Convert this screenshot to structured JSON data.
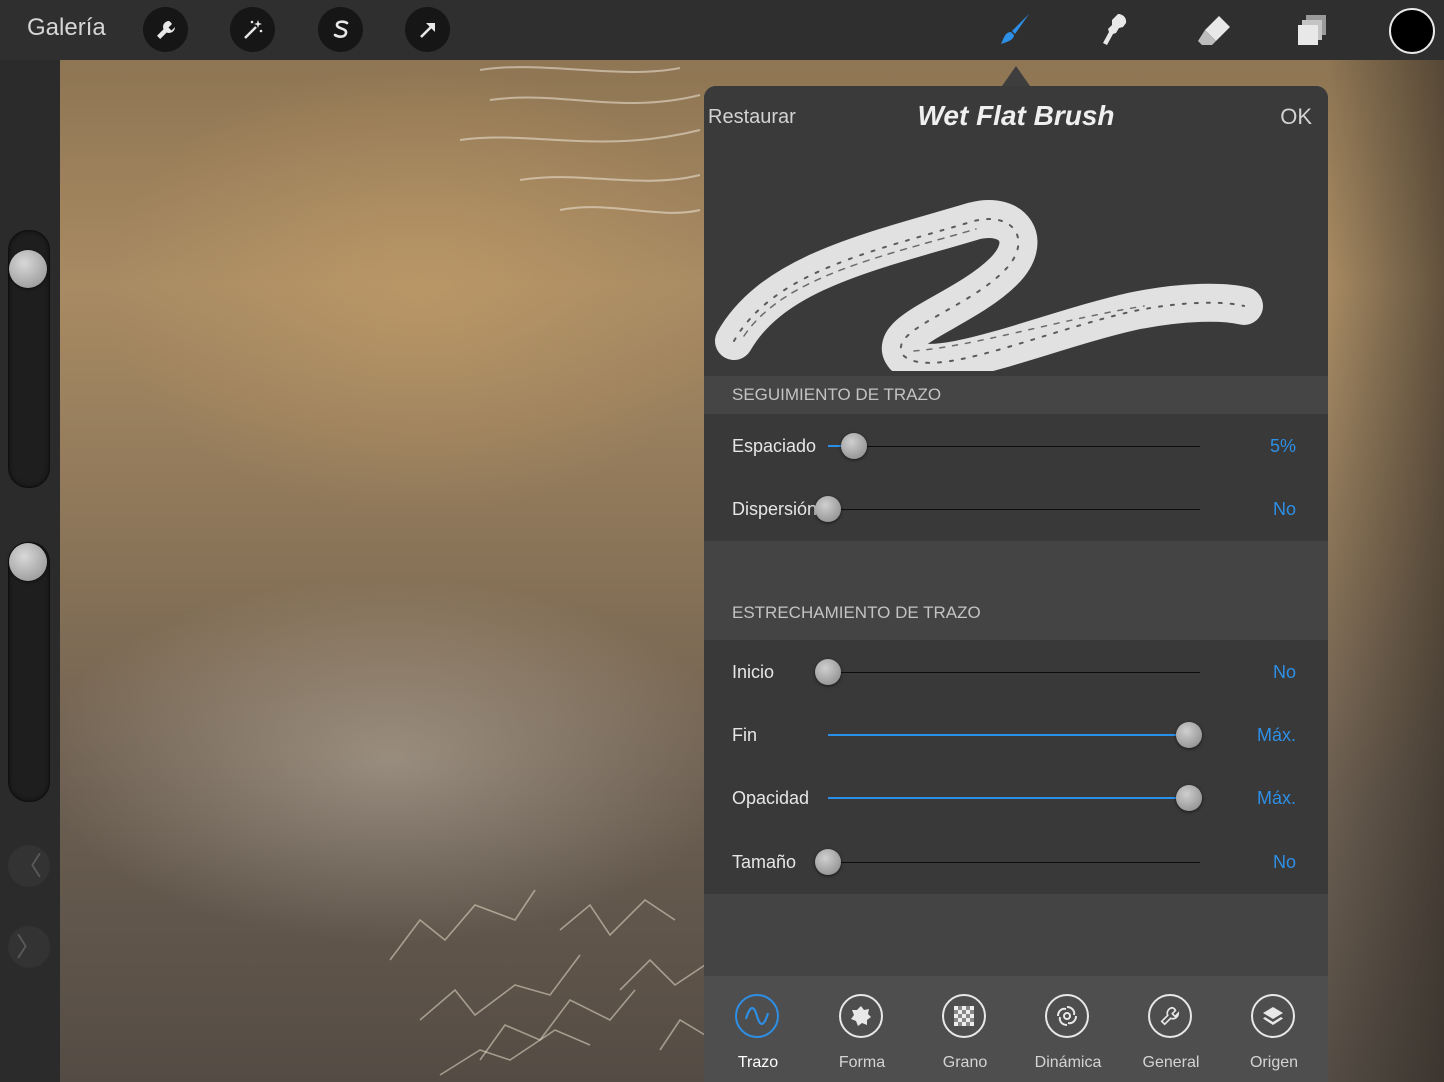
{
  "toolbar": {
    "gallery_label": "Galería",
    "left_tools": [
      {
        "icon": "wrench-icon"
      },
      {
        "icon": "magic-wand-icon"
      },
      {
        "icon": "selection-s-icon"
      },
      {
        "icon": "transform-arrow-icon"
      }
    ],
    "right_tools": [
      {
        "icon": "brush-icon",
        "active": true
      },
      {
        "icon": "smudge-icon"
      },
      {
        "icon": "eraser-icon"
      },
      {
        "icon": "layers-icon"
      }
    ],
    "current_color": "#000000",
    "accent_color": "#2e8fe6"
  },
  "sidebar": {
    "prev_glyph": "〈",
    "next_glyph": "〉"
  },
  "panel": {
    "reset_label": "Restaurar",
    "title": "Wet Flat Brush",
    "ok_label": "OK",
    "sections": [
      {
        "title": "SEGUIMIENTO DE TRAZO",
        "rows": [
          {
            "label": "Espaciado",
            "value": "5%",
            "level": 0.07
          },
          {
            "label": "Dispersión",
            "value": "No",
            "level": 0.0
          }
        ]
      },
      {
        "title": "ESTRECHAMIENTO DE TRAZO",
        "rows": [
          {
            "label": "Inicio",
            "value": "No",
            "level": 0.0
          },
          {
            "label": "Fin",
            "value": "Máx.",
            "level": 0.97
          },
          {
            "label": "Opacidad",
            "value": "Máx.",
            "level": 0.97
          },
          {
            "label": "Tamaño",
            "value": "No",
            "level": 0.0
          }
        ]
      }
    ],
    "tabs": [
      {
        "label": "Trazo",
        "icon": "wave-icon",
        "active": true
      },
      {
        "label": "Forma",
        "icon": "shape-icon",
        "active": false
      },
      {
        "label": "Grano",
        "icon": "grain-icon",
        "active": false
      },
      {
        "label": "Dinámica",
        "icon": "dynamics-icon",
        "active": false
      },
      {
        "label": "General",
        "icon": "wrench-icon",
        "active": false
      },
      {
        "label": "Origen",
        "icon": "layers-icon",
        "active": false
      }
    ]
  }
}
